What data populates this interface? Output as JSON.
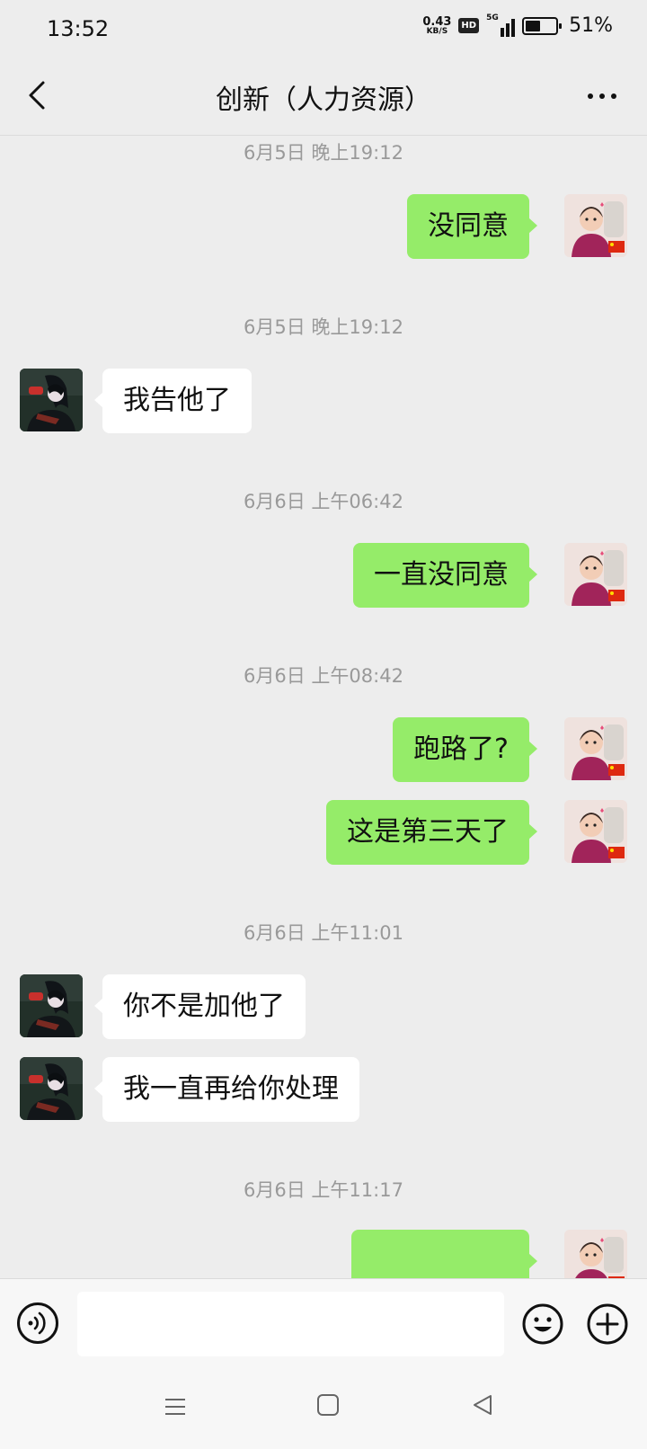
{
  "status_bar": {
    "time": "13:52",
    "net_speed_value": "0.43",
    "net_speed_unit": "KB/S",
    "hd_label": "HD",
    "network_type": "5G",
    "battery_percent": "51%",
    "battery_level": 0.51
  },
  "header": {
    "title": "创新（人力资源）"
  },
  "messages": [
    {
      "type": "timestamp",
      "text": "6月5日 晚上19:12"
    },
    {
      "type": "message",
      "sender": "me",
      "text": "没同意"
    },
    {
      "type": "timestamp",
      "text": "6月5日 晚上19:12"
    },
    {
      "type": "message",
      "sender": "other",
      "text": "我告他了"
    },
    {
      "type": "timestamp",
      "text": "6月6日 上午06:42"
    },
    {
      "type": "message",
      "sender": "me",
      "text": "一直没同意"
    },
    {
      "type": "timestamp",
      "text": "6月6日 上午08:42"
    },
    {
      "type": "message",
      "sender": "me",
      "text": "跑路了?"
    },
    {
      "type": "message",
      "sender": "me",
      "text": "这是第三天了"
    },
    {
      "type": "timestamp",
      "text": "6月6日 上午11:01"
    },
    {
      "type": "message",
      "sender": "other",
      "text": "你不是加他了"
    },
    {
      "type": "message",
      "sender": "other",
      "text": "我一直再给你处理"
    },
    {
      "type": "timestamp",
      "text": "6月6日 上午11:17"
    },
    {
      "type": "message",
      "sender": "me",
      "text": ""
    }
  ],
  "input": {
    "value": ""
  },
  "colors": {
    "background": "#ededed",
    "my_bubble": "#95ec69",
    "other_bubble": "#ffffff",
    "timestamp_text": "#999999"
  },
  "icons": {
    "back": "chevron-left-icon",
    "more": "more-dots-icon",
    "voice": "voice-icon",
    "emoji": "emoji-icon",
    "plus": "plus-icon"
  }
}
